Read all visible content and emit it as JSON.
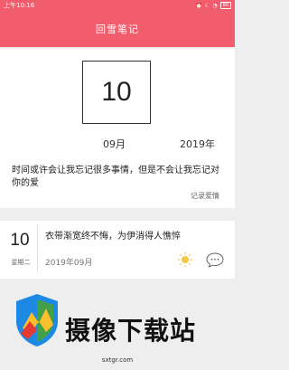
{
  "status": {
    "time": "上午10:16",
    "battery": "80"
  },
  "app": {
    "title": "回雪笔记"
  },
  "card1": {
    "day": "10",
    "month": "09月",
    "year": "2019年",
    "quote": "时间或许会让我忘记很多事情，但是不会让我忘记对你的爱",
    "tag": "记录爱情"
  },
  "note": {
    "day": "10",
    "weekday": "星期二",
    "title": "衣带渐宽终不悔，为伊消得人憔悴",
    "date": "2019年09月",
    "weather_icon": "sun-icon",
    "mood_icon": "chat-icon"
  },
  "watermark": {
    "text": "摄像下载站",
    "url": "sxtgr.com"
  },
  "colors": {
    "accent": "#f25d6e"
  }
}
